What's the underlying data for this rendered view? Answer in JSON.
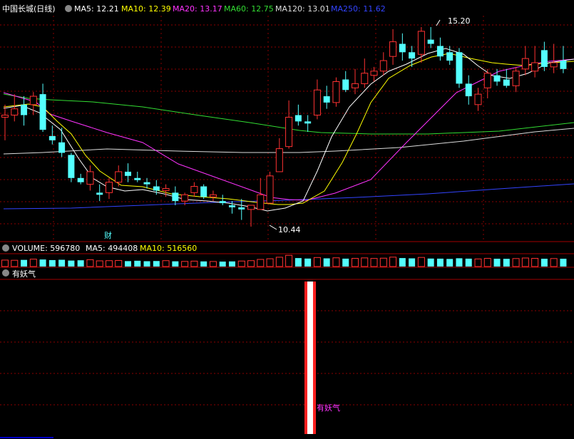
{
  "price_panel": {
    "title": "中国长城(日线)",
    "indicators": [
      {
        "label": "MA5: 12.21",
        "color": "#ffffff"
      },
      {
        "label": "MA10: 12.39",
        "color": "#ffff00"
      },
      {
        "label": "MA20: 13.17",
        "color": "#ff33ff"
      },
      {
        "label": "MA60: 12.75",
        "color": "#33dd33"
      },
      {
        "label": "MA120: 13.01",
        "color": "#dddddd"
      },
      {
        "label": "MA250: 11.62",
        "color": "#3344ff"
      }
    ],
    "high_label": "15.20",
    "low_label": "10.44",
    "marker_text": "财"
  },
  "volume_panel": {
    "title": "VOLUME: 596780",
    "indicators": [
      {
        "label": "MA5: 494408",
        "color": "#ffff00"
      },
      {
        "label": "MA10: 516560",
        "color": "#ffff00"
      }
    ]
  },
  "signal_panel": {
    "title": "有妖气",
    "signal_label": "有妖气"
  },
  "colors": {
    "background": "#000000",
    "up": "#ff3232",
    "down": "#54ffff",
    "grid": "#8b0000",
    "panel_border": "#a00000",
    "text": "#ffffff",
    "signal_text": "#ff33ff"
  },
  "chart_data": {
    "type": "candlestick",
    "ohlc": [
      [
        13.05,
        13.35,
        12.5,
        13.1
      ],
      [
        13.1,
        13.6,
        12.95,
        13.25
      ],
      [
        13.35,
        13.55,
        12.85,
        13.1
      ],
      [
        13.35,
        13.65,
        13.1,
        13.55
      ],
      [
        13.6,
        13.85,
        12.7,
        12.75
      ],
      [
        12.6,
        12.85,
        12.4,
        12.5
      ],
      [
        12.45,
        12.8,
        12.1,
        12.2
      ],
      [
        12.15,
        12.2,
        11.5,
        11.6
      ],
      [
        11.6,
        11.7,
        11.45,
        11.5
      ],
      [
        11.45,
        11.9,
        11.3,
        11.75
      ],
      [
        11.25,
        11.45,
        11.05,
        11.2
      ],
      [
        11.25,
        11.6,
        11.1,
        11.5
      ],
      [
        11.5,
        11.9,
        11.4,
        11.75
      ],
      [
        11.75,
        11.95,
        11.5,
        11.65
      ],
      [
        11.6,
        11.75,
        11.5,
        11.55
      ],
      [
        11.5,
        11.6,
        11.35,
        11.45
      ],
      [
        11.4,
        11.55,
        11.2,
        11.3
      ],
      [
        11.3,
        11.45,
        11.15,
        11.35
      ],
      [
        11.25,
        11.4,
        10.95,
        11.05
      ],
      [
        11.05,
        11.25,
        10.95,
        11.2
      ],
      [
        11.25,
        11.5,
        11.15,
        11.4
      ],
      [
        11.4,
        11.45,
        11.1,
        11.15
      ],
      [
        11.15,
        11.3,
        11.05,
        11.2
      ],
      [
        11.05,
        11.2,
        10.95,
        11.0
      ],
      [
        10.95,
        11.05,
        10.75,
        10.9
      ],
      [
        10.9,
        11.1,
        10.6,
        10.85
      ],
      [
        10.85,
        10.95,
        10.44,
        10.95
      ],
      [
        10.85,
        11.6,
        10.9,
        11.2
      ],
      [
        11.0,
        11.75,
        11.0,
        11.65
      ],
      [
        11.75,
        12.55,
        11.75,
        12.3
      ],
      [
        12.35,
        13.45,
        12.3,
        13.05
      ],
      [
        13.1,
        13.35,
        12.85,
        12.95
      ],
      [
        12.95,
        13.1,
        12.7,
        12.9
      ],
      [
        13.1,
        13.95,
        13.0,
        13.7
      ],
      [
        13.55,
        13.8,
        13.25,
        13.4
      ],
      [
        13.4,
        14.0,
        13.3,
        13.9
      ],
      [
        13.95,
        14.15,
        13.65,
        13.7
      ],
      [
        13.75,
        14.2,
        13.6,
        13.85
      ],
      [
        13.85,
        14.45,
        13.75,
        14.1
      ],
      [
        14.05,
        14.25,
        13.9,
        14.15
      ],
      [
        14.15,
        14.6,
        14.05,
        14.4
      ],
      [
        14.5,
        15.15,
        14.3,
        14.85
      ],
      [
        14.8,
        15.05,
        14.4,
        14.6
      ],
      [
        14.6,
        14.75,
        14.25,
        14.45
      ],
      [
        14.55,
        15.2,
        14.35,
        15.1
      ],
      [
        14.9,
        15.2,
        14.7,
        14.8
      ],
      [
        14.75,
        14.95,
        14.4,
        14.5
      ],
      [
        14.6,
        14.75,
        14.3,
        14.4
      ],
      [
        14.6,
        14.7,
        13.75,
        13.85
      ],
      [
        13.85,
        14.05,
        13.35,
        13.55
      ],
      [
        13.35,
        13.75,
        13.2,
        13.6
      ],
      [
        13.75,
        14.2,
        13.5,
        14.1
      ],
      [
        14.05,
        14.2,
        13.8,
        13.9
      ],
      [
        13.95,
        14.2,
        13.75,
        13.8
      ],
      [
        13.8,
        14.25,
        13.65,
        14.15
      ],
      [
        14.2,
        14.75,
        14.05,
        14.45
      ],
      [
        14.15,
        14.75,
        14.0,
        14.35
      ],
      [
        14.65,
        14.85,
        14.15,
        14.25
      ],
      [
        14.25,
        14.8,
        14.1,
        14.35
      ],
      [
        14.4,
        14.75,
        14.1,
        14.2
      ]
    ],
    "volume": [
      [
        68,
        true
      ],
      [
        66,
        true
      ],
      [
        70,
        false
      ],
      [
        78,
        true
      ],
      [
        74,
        false
      ],
      [
        68,
        false
      ],
      [
        71,
        false
      ],
      [
        63,
        false
      ],
      [
        66,
        false
      ],
      [
        72,
        true
      ],
      [
        60,
        true
      ],
      [
        62,
        true
      ],
      [
        64,
        true
      ],
      [
        57,
        false
      ],
      [
        61,
        false
      ],
      [
        56,
        false
      ],
      [
        58,
        false
      ],
      [
        62,
        true
      ],
      [
        55,
        false
      ],
      [
        54,
        true
      ],
      [
        57,
        true
      ],
      [
        54,
        false
      ],
      [
        53,
        true
      ],
      [
        52,
        false
      ],
      [
        54,
        false
      ],
      [
        58,
        true
      ],
      [
        62,
        true
      ],
      [
        75,
        true
      ],
      [
        82,
        true
      ],
      [
        98,
        true
      ],
      [
        118,
        true
      ],
      [
        89,
        false
      ],
      [
        84,
        false
      ],
      [
        95,
        true
      ],
      [
        86,
        false
      ],
      [
        92,
        true
      ],
      [
        83,
        false
      ],
      [
        86,
        true
      ],
      [
        91,
        true
      ],
      [
        85,
        true
      ],
      [
        88,
        true
      ],
      [
        99,
        true
      ],
      [
        89,
        false
      ],
      [
        86,
        false
      ],
      [
        96,
        true
      ],
      [
        84,
        false
      ],
      [
        83,
        false
      ],
      [
        80,
        false
      ],
      [
        87,
        false
      ],
      [
        83,
        false
      ],
      [
        80,
        true
      ],
      [
        86,
        true
      ],
      [
        82,
        false
      ],
      [
        81,
        false
      ],
      [
        84,
        true
      ],
      [
        90,
        true
      ],
      [
        86,
        true
      ],
      [
        82,
        false
      ],
      [
        84,
        true
      ],
      [
        82,
        false
      ]
    ],
    "signal_index": 30
  }
}
